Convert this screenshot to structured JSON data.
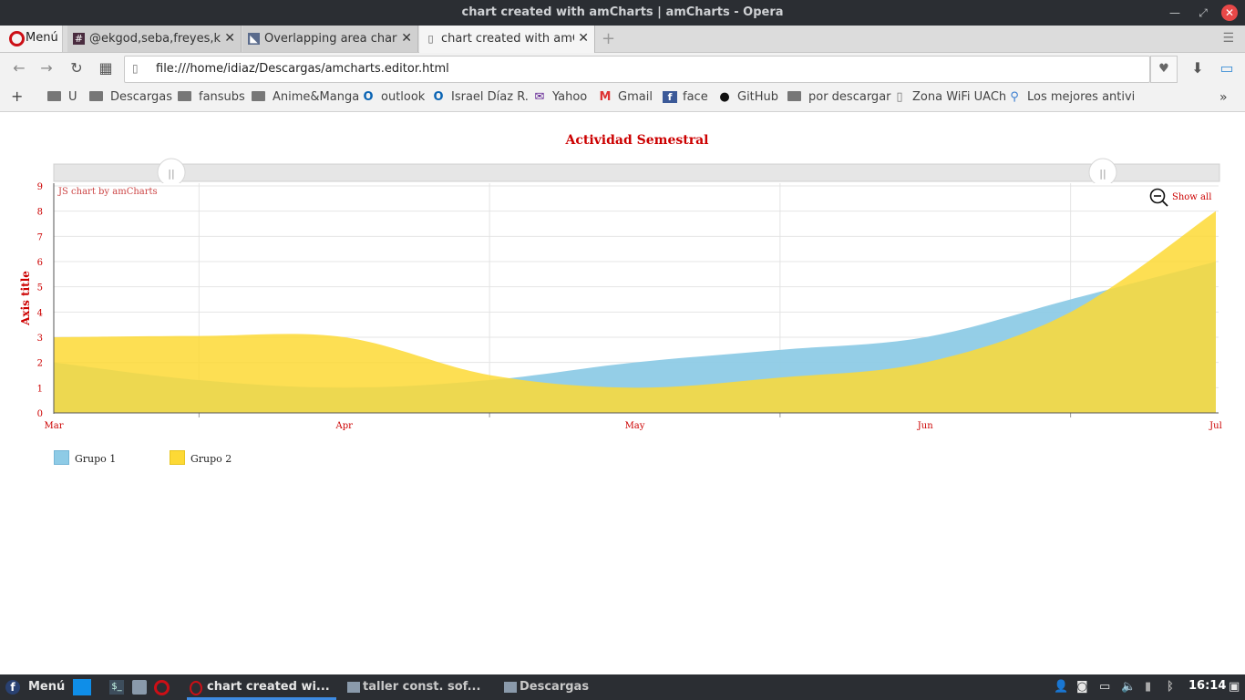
{
  "window": {
    "title": "chart created with amCharts | amCharts - Opera"
  },
  "browser": {
    "menu_label": "Menú",
    "tabs": [
      {
        "label": "@ekgod,seba,freyes,kiwi",
        "favicon": "hash-icon",
        "active": false
      },
      {
        "label": "Overlapping area chart - ",
        "favicon": "amcharts-icon",
        "active": false
      },
      {
        "label": "chart created with amCh",
        "favicon": "page-icon",
        "active": true
      }
    ],
    "url": "file:///home/idiaz/Descargas/amcharts.editor.html",
    "bookmarks": [
      {
        "label": "U",
        "icon": "folder-icon"
      },
      {
        "label": "Descargas",
        "icon": "folder-icon"
      },
      {
        "label": "fansubs",
        "icon": "folder-icon"
      },
      {
        "label": "Anime&Manga",
        "icon": "folder-icon"
      },
      {
        "label": "outlook",
        "icon": "outlook-icon"
      },
      {
        "label": "Israel Díaz R.",
        "icon": "outlook-icon"
      },
      {
        "label": "Yahoo",
        "icon": "mail-icon"
      },
      {
        "label": "Gmail",
        "icon": "gmail-icon"
      },
      {
        "label": "face",
        "icon": "facebook-icon"
      },
      {
        "label": "GitHub",
        "icon": "github-icon"
      },
      {
        "label": "por descargar",
        "icon": "folder-icon"
      },
      {
        "label": "Zona WiFi UACh",
        "icon": "page-icon"
      },
      {
        "label": "Los mejores antiviru",
        "icon": "search-icon"
      }
    ]
  },
  "chart_data": {
    "type": "area",
    "title": "Actividad Semestral",
    "credit": "JS chart by amCharts",
    "zoom_label": "Show all",
    "ylabel": "Axis title",
    "ylim": [
      0,
      9
    ],
    "yticks": [
      "0",
      "1",
      "2",
      "3",
      "4",
      "5",
      "6",
      "7",
      "8",
      "9"
    ],
    "xticks": [
      "Mar",
      "Apr",
      "May",
      "Jun",
      "Jul"
    ],
    "x": [
      0,
      0.5,
      1,
      1.5,
      2,
      2.5,
      3,
      3.5,
      4
    ],
    "series": [
      {
        "name": "Grupo 1",
        "color": "#8ecbe6",
        "values": [
          2,
          1.3,
          1,
          1.3,
          2,
          2.5,
          3,
          4.5,
          6
        ]
      },
      {
        "name": "Grupo 2",
        "color": "#fdd935",
        "values": [
          3,
          3.05,
          3,
          1.5,
          1,
          1.4,
          2,
          4,
          8
        ]
      }
    ],
    "overlap_color": "#dccf42",
    "accent_color": "#cc0000",
    "legend_position": "bottom-left"
  },
  "taskbar": {
    "menu_label": "Menú",
    "apps": [
      {
        "label": "chart created wi...",
        "icon": "opera-icon",
        "active": true
      },
      {
        "label": "taller const. sof...",
        "icon": "folder-icon",
        "active": false
      },
      {
        "label": "Descargas",
        "icon": "folder-icon",
        "active": false
      }
    ],
    "clock": "16:14"
  }
}
